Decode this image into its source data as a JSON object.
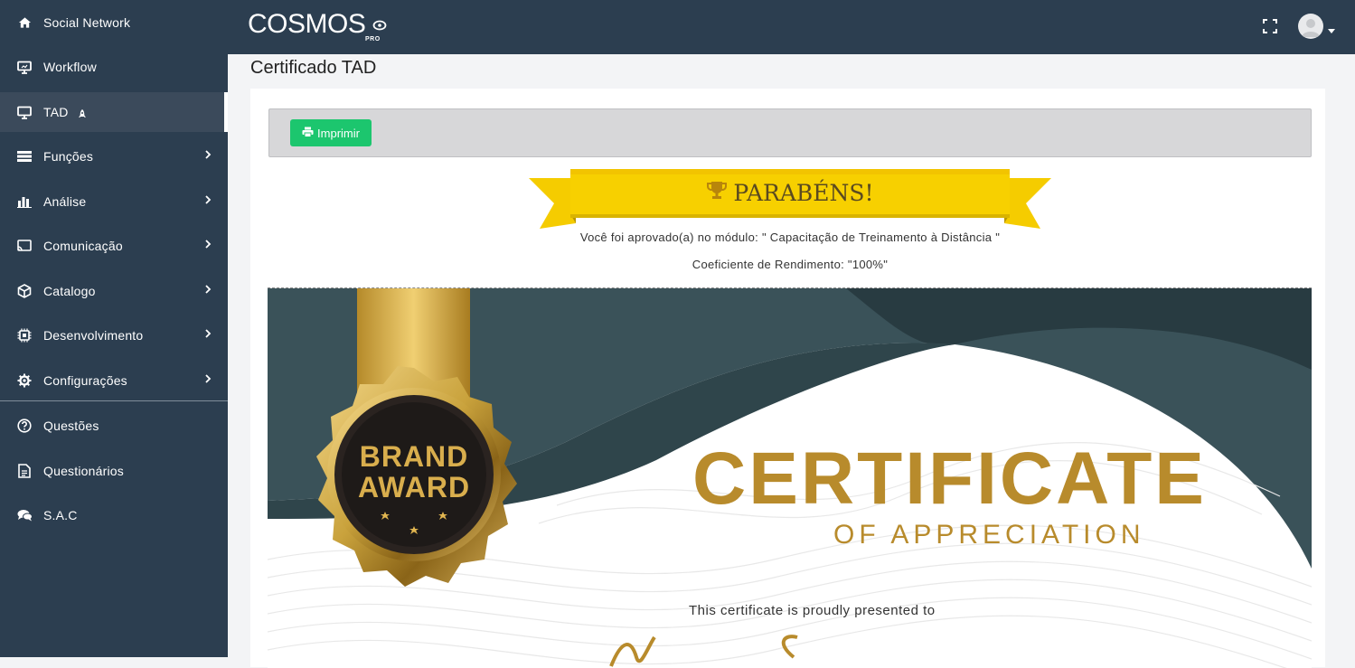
{
  "sidebar": {
    "items": [
      {
        "label": "Social Network",
        "icon": "home-icon",
        "has_submenu": false,
        "active": false
      },
      {
        "label": "Workflow",
        "icon": "monitor-icon",
        "has_submenu": false,
        "active": false
      },
      {
        "label": "TAD",
        "icon": "desktop-icon",
        "has_submenu": false,
        "active": true
      },
      {
        "label": "Funções",
        "icon": "list-icon",
        "has_submenu": true,
        "active": false
      },
      {
        "label": "Análise",
        "icon": "bar-chart-icon",
        "has_submenu": true,
        "active": false
      },
      {
        "label": "Comunicação",
        "icon": "cast-icon",
        "has_submenu": true,
        "active": false
      },
      {
        "label": "Catalogo",
        "icon": "cube-icon",
        "has_submenu": true,
        "active": false
      },
      {
        "label": "Desenvolvimento",
        "icon": "chip-icon",
        "has_submenu": true,
        "active": false
      },
      {
        "label": "Configurações",
        "icon": "gear-icon",
        "has_submenu": true,
        "active": false
      },
      {
        "label": "Questões",
        "icon": "question-circle-icon",
        "has_submenu": false,
        "active": false
      },
      {
        "label": "Questionários",
        "icon": "document-icon",
        "has_submenu": false,
        "active": false
      },
      {
        "label": "S.A.C",
        "icon": "chat-icon",
        "has_submenu": false,
        "active": false
      }
    ]
  },
  "header": {
    "logo_text": "COSMOS",
    "logo_badge": "PRO"
  },
  "page": {
    "title": "Certificado TAD",
    "print_label": "Imprimir",
    "banner_text": "PARABÉNS!",
    "approval_message": "Você foi aprovado(a) no módulo: \" Capacitação de Treinamento à Distância \"",
    "score_message": "Coeficiente de Rendimento: \"100%\""
  },
  "certificate": {
    "seal_line1": "BRAND",
    "seal_line2": "AWARD",
    "heading": "CERTIFICATE",
    "subheading": "OF APPRECIATION",
    "presented_to": "This certificate is proudly presented to"
  },
  "colors": {
    "sidebar_bg": "#2c3e50",
    "accent_green": "#1cc66e",
    "banner_yellow": "#f7d000",
    "cert_teal": "#3a5259",
    "gold": "#c9a23c"
  }
}
